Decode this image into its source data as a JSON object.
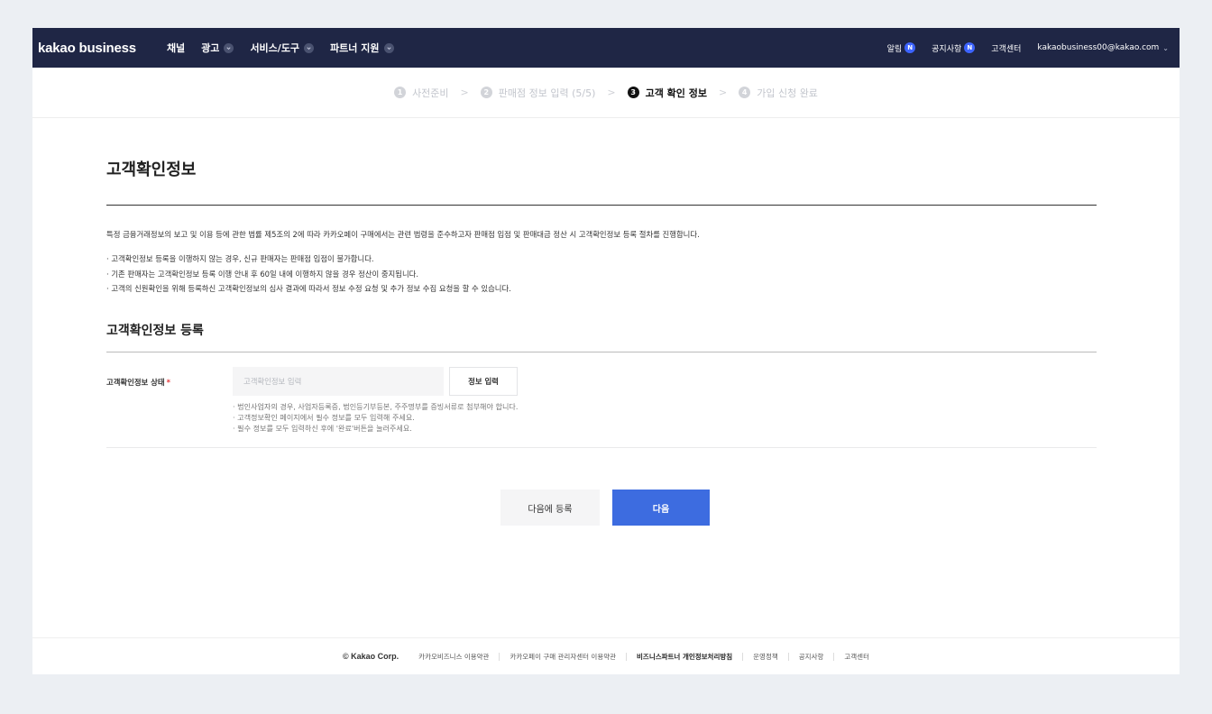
{
  "header": {
    "logo": "kakao business",
    "nav": [
      {
        "label": "채널",
        "dropdown": false
      },
      {
        "label": "광고",
        "dropdown": true
      },
      {
        "label": "서비스/도구",
        "dropdown": true
      },
      {
        "label": "파트너 지원",
        "dropdown": true
      }
    ],
    "right": {
      "alerts_label": "알림",
      "notices_label": "공지사항",
      "badge": "N",
      "help_label": "고객센터",
      "email": "kakaobusiness00@kakao.com"
    }
  },
  "stepper": {
    "steps": [
      {
        "num": "1",
        "label": "사전준비"
      },
      {
        "num": "2",
        "label": "판매점 정보 입력 (5/5)"
      },
      {
        "num": "3",
        "label": "고객 확인 정보"
      },
      {
        "num": "4",
        "label": "가입 신청 완료"
      }
    ],
    "separator": ">",
    "active_index": 2
  },
  "main": {
    "title": "고객확인정보",
    "intro": "특정 금융거래정보의 보고 및 이용 등에 관한 법률 제5조의 2에 따라 카카오페이 구매에서는 관련 법령을 준수하고자 판매점 입점 및 판매대금 정산 시 고객확인정보 등록 절차를 진행합니다.",
    "bullets": [
      "· 고객확인정보 등록을 이행하지 않는 경우, 신규 판매자는 판매점 입점이 불가합니다.",
      "· 기존 판매자는 고객확인정보 등록 이행 안내 후 60일 내에 이행하지 않을 경우 정산이 중지됩니다.",
      "· 고객의 신원확인을 위해 등록하신 고객확인정보의 심사 결과에 따라서 정보 수정 요청 및 추가 정보 수집 요청을 할 수 있습니다."
    ],
    "section_title": "고객확인정보 등록",
    "form": {
      "label": "고객확인정보 상태",
      "required_mark": "*",
      "input_placeholder": "고객확인정보 입력",
      "input_value": "",
      "button_label": "정보 입력",
      "notes": [
        "· 법인사업자의 경우, 사업자등록증, 법인등기부등본, 주주명부를 증빙서류로 첨부해야 합니다.",
        "· 고객정보확인 페이지에서 필수 정보를 모두 입력해 주세요.",
        "· 필수 정보를 모두 입력하신 후에 '완료'버튼을 눌러주세요."
      ]
    },
    "actions": {
      "later_label": "다음에 등록",
      "next_label": "다음"
    }
  },
  "footer": {
    "copyright": "© Kakao Corp.",
    "links": [
      {
        "label": "카카오비즈니스 이용약관",
        "bold": false
      },
      {
        "label": "카카오페이 구매 관리자센터 이용약관",
        "bold": false
      },
      {
        "label": "비즈니스파트너 개인정보처리방침",
        "bold": true
      },
      {
        "label": "운영정책",
        "bold": false
      },
      {
        "label": "공지사항",
        "bold": false
      },
      {
        "label": "고객센터",
        "bold": false
      }
    ]
  },
  "colors": {
    "nav_bg": "#1f2645",
    "accent": "#3d6ce0",
    "badge": "#3d64ff",
    "required": "#e5393b"
  }
}
